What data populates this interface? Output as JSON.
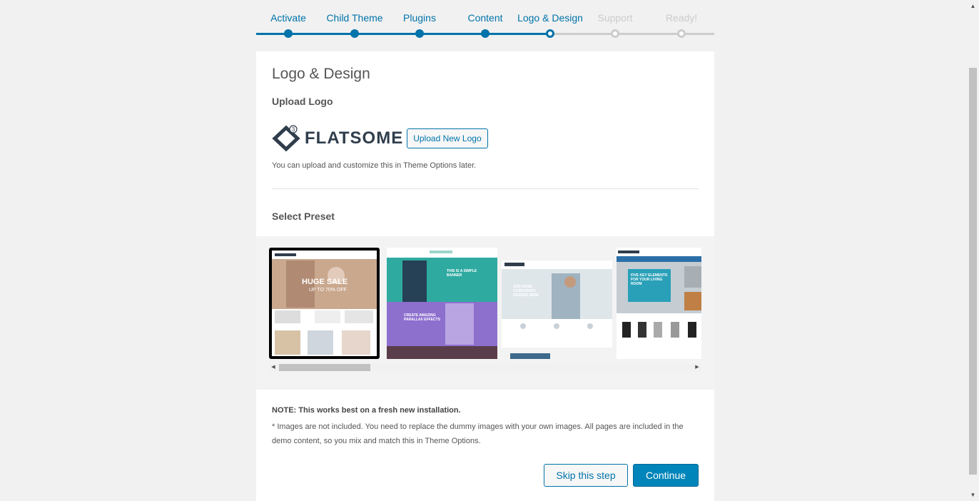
{
  "steps": [
    {
      "label": "Activate",
      "state": "done"
    },
    {
      "label": "Child Theme",
      "state": "done"
    },
    {
      "label": "Plugins",
      "state": "done"
    },
    {
      "label": "Content",
      "state": "done"
    },
    {
      "label": "Logo & Design",
      "state": "current"
    },
    {
      "label": "Support",
      "state": "todo"
    },
    {
      "label": "Ready!",
      "state": "todo"
    }
  ],
  "page": {
    "title": "Logo & Design",
    "upload_logo_label": "Upload Logo",
    "logo_text": "FLATSOME",
    "upload_button": "Upload New Logo",
    "help_text": "You can upload and customize this in Theme Options later.",
    "select_preset_label": "Select Preset",
    "note_bold": "NOTE: This works best on a fresh new installation.",
    "note_text": "* Images are not included. You need to replace the dummy images with your own images. All pages are included in the demo content, so you mix and match this in Theme Options.",
    "skip_button": "Skip this step",
    "continue_button": "Continue"
  },
  "presets": {
    "selected_index": 0,
    "items": [
      {
        "name": "preset-shop-fashion",
        "headline": "HUGE SALE",
        "sub": "UP TO 70% OFF"
      },
      {
        "name": "preset-simple-banner",
        "headline": "THIS IS A SIMPLE BANNER",
        "sub": "CREATE AMAZING PARALLAX EFFECTS"
      },
      {
        "name": "preset-corporate",
        "headline": "ADD SOME CORPORATE HEADER HERE",
        "sub": ""
      },
      {
        "name": "preset-furniture",
        "headline": "FIVE KEY ELEMENTS FOR YOUR LIVING ROOM",
        "sub": ""
      }
    ]
  },
  "colors": {
    "accent": "#0073aa",
    "inactive": "#cccccc",
    "primary_button": "#0085ba"
  }
}
